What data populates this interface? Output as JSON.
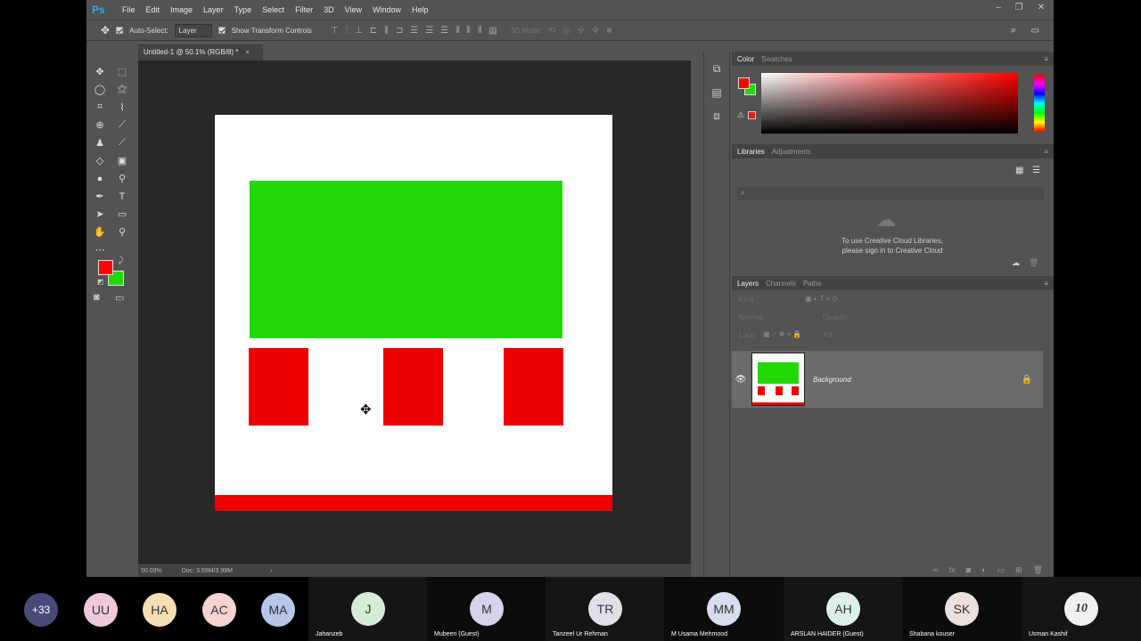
{
  "app": {
    "logo": "Ps",
    "menus": [
      "File",
      "Edit",
      "Image",
      "Layer",
      "Type",
      "Select",
      "Filter",
      "3D",
      "View",
      "Window",
      "Help"
    ]
  },
  "options": {
    "auto_select_label": "Auto-Select:",
    "auto_select_value": "Layer",
    "show_transform_label": "Show Transform Controls",
    "mode_3d": "3D Mode:"
  },
  "document": {
    "tab_title": "Untitled-1 @ 50.1% (RGB/8) *",
    "zoom": "50.09%",
    "doc_info": "Doc: 3.99M/3.99M"
  },
  "colors": {
    "foreground": "#ff0000",
    "background": "#21d806"
  },
  "color_panel": {
    "tabs": [
      "Color",
      "Swatches"
    ]
  },
  "libraries": {
    "tabs": [
      "Libraries",
      "Adjustments"
    ],
    "message_line1": "To use Creative Cloud Libraries,",
    "message_line2": "please sign in to Creative Cloud"
  },
  "layers_panel": {
    "tabs": [
      "Layers",
      "Channels",
      "Paths"
    ],
    "kind_placeholder": "Kind",
    "blend_mode": "Normal",
    "opacity_label": "Opacity:",
    "lock_label": "Lock:",
    "fill_label": "Fill:",
    "layer_name": "Background"
  },
  "participants": [
    {
      "initials": "+33",
      "name": "",
      "color": "#4a4a78"
    },
    {
      "initials": "UU",
      "name": "",
      "color": "#f0c8dc"
    },
    {
      "initials": "HA",
      "name": "",
      "color": "#f5deb3"
    },
    {
      "initials": "AC",
      "name": "",
      "color": "#f6d2d2"
    },
    {
      "initials": "MA",
      "name": "",
      "color": "#b7c6e8"
    },
    {
      "initials": "J",
      "name": "Jahanzeb",
      "color": "#d4ecd8"
    },
    {
      "initials": "M",
      "name": "Mubeen (Guest)",
      "color": "#d6d2ec"
    },
    {
      "initials": "TR",
      "name": "Tanzeel Ur Rehman",
      "color": "#e0e0e8"
    },
    {
      "initials": "MM",
      "name": "M Usama Mehmood",
      "color": "#d8dcef"
    },
    {
      "initials": "AH",
      "name": "ARSLAN HAIDER (Guest)",
      "color": "#dcefe8"
    },
    {
      "initials": "SK",
      "name": "Shabana kouser",
      "color": "#ece0dc"
    },
    {
      "initials": "10",
      "name": "Usman Kashif",
      "color": "#f0f0f0"
    }
  ]
}
